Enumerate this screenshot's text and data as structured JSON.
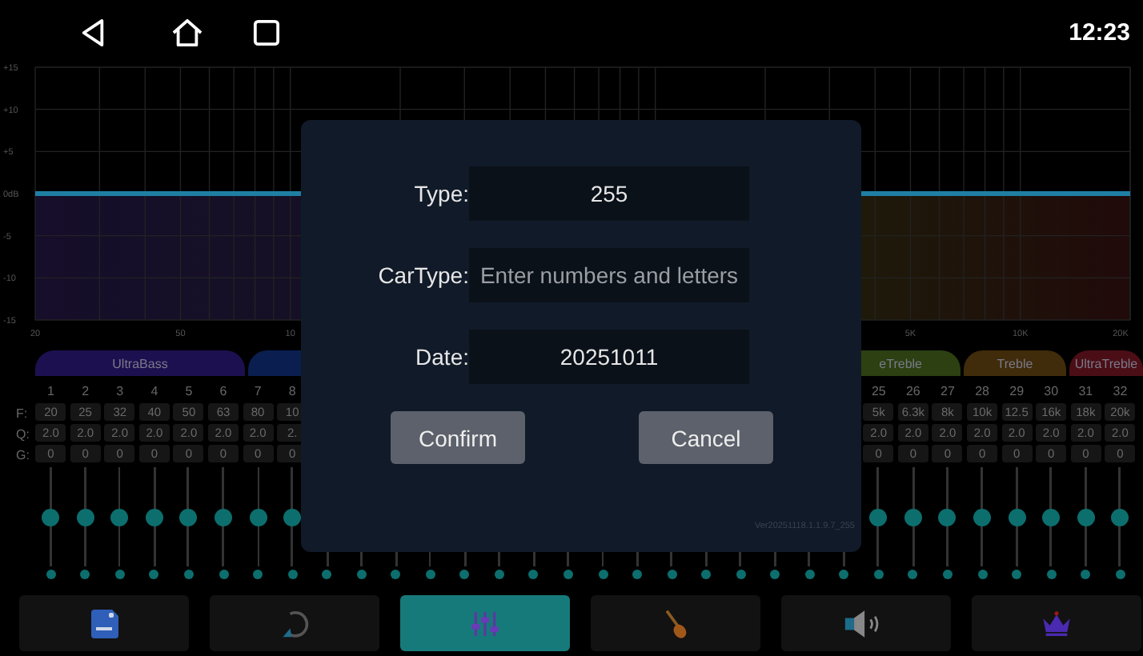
{
  "status_bar": {
    "time": "12:23"
  },
  "graph": {
    "y_labels": [
      "+15",
      "+10",
      "+5",
      "0dB",
      "-5",
      "-10",
      "-15"
    ],
    "x_labels": [
      "20",
      "50",
      "10",
      "5K",
      "10K",
      "20K"
    ]
  },
  "band_tabs": [
    {
      "label": "UltraBass",
      "color": "#1d1050"
    },
    {
      "color": "#0a1e50"
    },
    {
      "label": "eTreble",
      "color": "#2c4012"
    },
    {
      "label": "Treble",
      "color": "#402c0b"
    },
    {
      "label": "UltraTreble",
      "color": "#4b0e17"
    }
  ],
  "row_labels": [
    "F:",
    "Q:",
    "G:"
  ],
  "channels_left": [
    {
      "number": "1",
      "f": "20",
      "q": "2.0",
      "g": "0",
      "level": 0.5
    },
    {
      "number": "2",
      "f": "25",
      "q": "2.0",
      "g": "0",
      "level": 0.5
    },
    {
      "number": "3",
      "f": "32",
      "q": "2.0",
      "g": "0",
      "level": 0.5
    },
    {
      "number": "4",
      "f": "40",
      "q": "2.0",
      "g": "0",
      "level": 0.5
    },
    {
      "number": "5",
      "f": "50",
      "q": "2.0",
      "g": "0",
      "level": 0.5
    },
    {
      "number": "6",
      "f": "63",
      "q": "2.0",
      "g": "0",
      "level": 0.5
    },
    {
      "number": "7",
      "f": "80",
      "q": "2.0",
      "g": "0",
      "level": 0.5
    },
    {
      "number": "8",
      "f": "10",
      "q": "2.",
      "g": "0",
      "level": 0.5
    }
  ],
  "channels_right": [
    {
      "number": "25",
      "f": "5k",
      "q": "2.0",
      "g": "0",
      "level": 0.5
    },
    {
      "number": "26",
      "f": "6.3k",
      "q": "2.0",
      "g": "0",
      "level": 0.5
    },
    {
      "number": "27",
      "f": "8k",
      "q": "2.0",
      "g": "0",
      "level": 0.5
    },
    {
      "number": "28",
      "f": "10k",
      "q": "2.0",
      "g": "0",
      "level": 0.5
    },
    {
      "number": "29",
      "f": "12.5",
      "q": "2.0",
      "g": "0",
      "level": 0.5
    },
    {
      "number": "30",
      "f": "16k",
      "q": "2.0",
      "g": "0",
      "level": 0.5
    },
    {
      "number": "31",
      "f": "18k",
      "q": "2.0",
      "g": "0",
      "level": 0.5
    },
    {
      "number": "32",
      "f": "20k",
      "q": "2.0",
      "g": "0",
      "level": 0.5
    }
  ],
  "toolbar": [
    {
      "kind": "save",
      "selected": false
    },
    {
      "kind": "undo",
      "selected": false
    },
    {
      "kind": "mixer",
      "selected": true
    },
    {
      "kind": "instrument",
      "selected": false
    },
    {
      "kind": "speaker",
      "selected": false
    },
    {
      "kind": "crown",
      "selected": false
    }
  ],
  "dialog": {
    "fields": [
      {
        "label": "Type:",
        "value": "255"
      },
      {
        "label": "CarType:",
        "placeholder": "Enter numbers and letters"
      },
      {
        "label": "Date:",
        "value": "20251011"
      }
    ],
    "buttons": [
      "Confirm",
      "Cancel"
    ],
    "version": "Ver20251118.1.1.9.7_255"
  }
}
